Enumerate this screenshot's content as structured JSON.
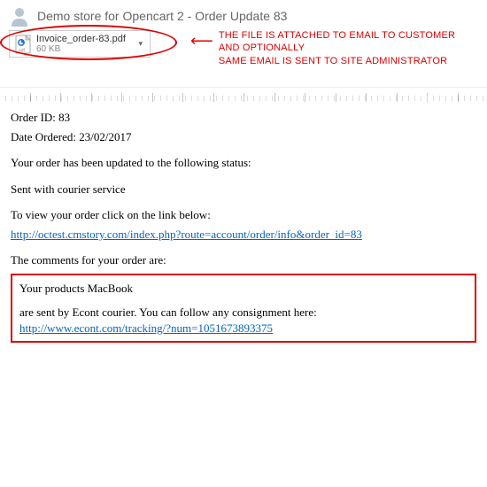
{
  "header": {
    "subject": "Demo store for Opencart 2 - Order Update 83"
  },
  "attachment": {
    "name": "Invoice_order-83.pdf",
    "size": "60 KB"
  },
  "annotation": {
    "line1": "THE FILE IS ATTACHED TO EMAIL TO CUSTOMER",
    "line2": "AND OPTIONALLY",
    "line3": "SAME EMAIL IS SENT TO SITE ADMINISTRATOR"
  },
  "body": {
    "order_id_label": "Order ID: 83",
    "date_label": "Date Ordered: 23/02/2017",
    "status_intro": "Your order has been updated to the following status:",
    "status_value": "Sent with courier service",
    "link_intro": "To view your order click on the link below:",
    "order_link": "http://octest.cmstory.com/index.php?route=account/order/info&order_id=83",
    "comments_intro": "The comments for your order are:",
    "comment_line1": "Your products MacBook",
    "comment_line2_prefix": "are sent by Econt courier. You can follow any consignment here: ",
    "tracking_link": "http://www.econt.com/tracking/?num=1051673893375"
  }
}
